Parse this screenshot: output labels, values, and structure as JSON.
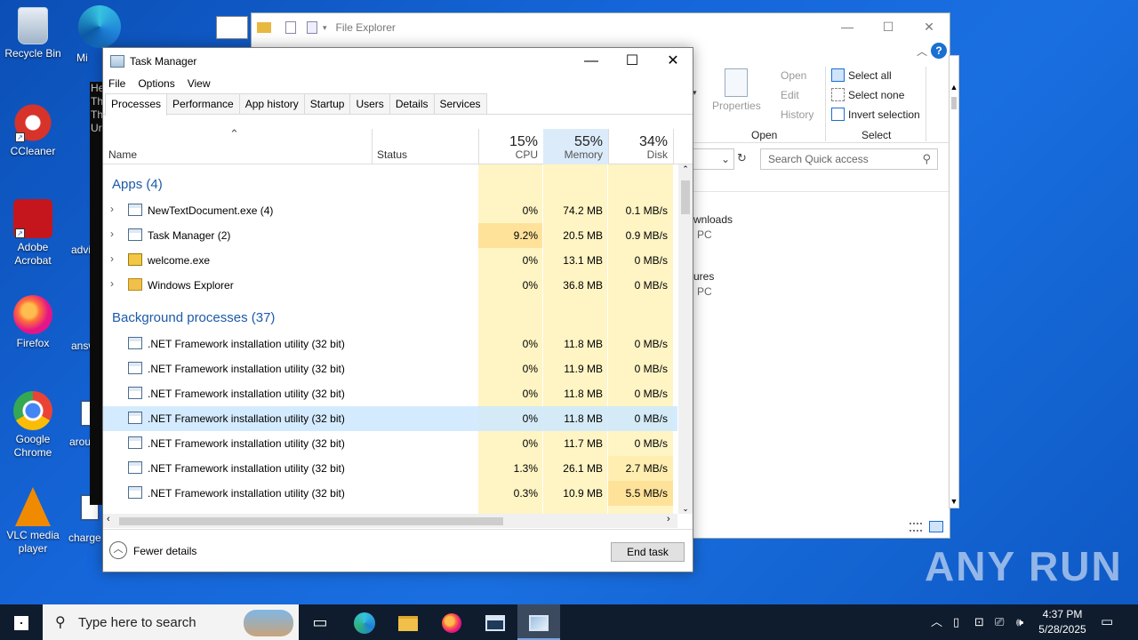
{
  "desktop": {
    "icons": [
      {
        "label": "Recycle Bin"
      },
      {
        "label": "CCleaner"
      },
      {
        "label": "Adobe Acrobat"
      },
      {
        "label": "Firefox"
      },
      {
        "label": "Google Chrome"
      },
      {
        "label": "VLC media player"
      }
    ],
    "partial_labels": [
      "Mi",
      "advi",
      "answ",
      "arou",
      "charge"
    ]
  },
  "file_explorer": {
    "title": "File Explorer",
    "ribbon": {
      "open": "Open",
      "edit": "Edit",
      "history": "History",
      "properties": "Properties",
      "select_all": "Select all",
      "select_none": "Select none",
      "invert_selection": "Invert selection",
      "group_open": "Open",
      "group_select": "Select"
    },
    "search_placeholder": "Search Quick access",
    "items": [
      {
        "line1": "wnloads",
        "line2": "PC"
      },
      {
        "line1": "ures",
        "line2": "PC"
      }
    ]
  },
  "task_manager": {
    "title": "Task Manager",
    "menu": [
      "File",
      "Options",
      "View"
    ],
    "tabs": [
      "Processes",
      "Performance",
      "App history",
      "Startup",
      "Users",
      "Details",
      "Services"
    ],
    "active_tab": "Processes",
    "columns": {
      "name": "Name",
      "status": "Status",
      "cpu": {
        "pct": "15%",
        "label": "CPU"
      },
      "memory": {
        "pct": "55%",
        "label": "Memory"
      },
      "disk": {
        "pct": "34%",
        "label": "Disk"
      }
    },
    "groups": {
      "apps": "Apps (4)",
      "background": "Background processes (37)"
    },
    "apps": [
      {
        "name": "NewTextDocument.exe (4)",
        "cpu": "0%",
        "memory": "74.2 MB",
        "disk": "0.1 MB/s"
      },
      {
        "name": "Task Manager (2)",
        "cpu": "9.2%",
        "memory": "20.5 MB",
        "disk": "0.9 MB/s"
      },
      {
        "name": "welcome.exe",
        "cpu": "0%",
        "memory": "13.1 MB",
        "disk": "0 MB/s"
      },
      {
        "name": "Windows Explorer",
        "cpu": "0%",
        "memory": "36.8 MB",
        "disk": "0 MB/s"
      }
    ],
    "background": [
      {
        "name": ".NET Framework installation utility (32 bit)",
        "cpu": "0%",
        "memory": "11.8 MB",
        "disk": "0 MB/s"
      },
      {
        "name": ".NET Framework installation utility (32 bit)",
        "cpu": "0%",
        "memory": "11.9 MB",
        "disk": "0 MB/s"
      },
      {
        "name": ".NET Framework installation utility (32 bit)",
        "cpu": "0%",
        "memory": "11.8 MB",
        "disk": "0 MB/s"
      },
      {
        "name": ".NET Framework installation utility (32 bit)",
        "cpu": "0%",
        "memory": "11.8 MB",
        "disk": "0 MB/s"
      },
      {
        "name": ".NET Framework installation utility (32 bit)",
        "cpu": "0%",
        "memory": "11.7 MB",
        "disk": "0 MB/s"
      },
      {
        "name": ".NET Framework installation utility (32 bit)",
        "cpu": "1.3%",
        "memory": "26.1 MB",
        "disk": "2.7 MB/s"
      },
      {
        "name": ".NET Framework installation utility (32 bit)",
        "cpu": "0.3%",
        "memory": "10.9 MB",
        "disk": "5.5 MB/s"
      }
    ],
    "fewer_details": "Fewer details",
    "end_task": "End task"
  },
  "taskbar": {
    "search_placeholder": "Type here to search",
    "time": "4:37 PM",
    "date": "5/28/2025"
  },
  "watermark": "ANY RUN"
}
